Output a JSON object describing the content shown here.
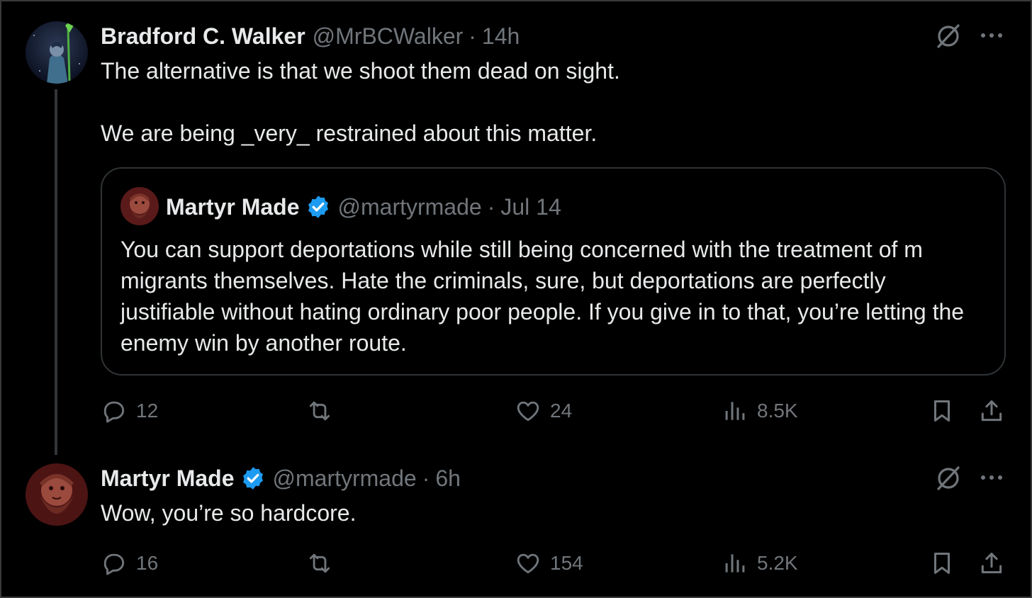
{
  "tweets": [
    {
      "name": "Bradford C. Walker",
      "handle": "@MrBCWalker",
      "separator": "·",
      "time": "14h",
      "verified": false,
      "text": "The alternative is that we shoot them dead on sight.\n\nWe are being _very_ restrained about this matter.",
      "quote": {
        "name": "Martyr Made",
        "handle": "@martyrmade",
        "separator": "·",
        "time": "Jul 14",
        "verified": true,
        "text": "You can support deportations while still being concerned with the treatment of m migrants themselves. Hate the criminals, sure, but deportations are perfectly justifiable without hating ordinary poor people. If you give in to that, you’re letting the enemy win by another route."
      },
      "actions": {
        "replies": "12",
        "reposts": "",
        "likes": "24",
        "views": "8.5K"
      }
    },
    {
      "name": "Martyr Made",
      "handle": "@martyrmade",
      "separator": "·",
      "time": "6h",
      "verified": true,
      "text": "Wow, you’re so hardcore.",
      "actions": {
        "replies": "16",
        "reposts": "",
        "likes": "154",
        "views": "5.2K"
      }
    }
  ],
  "icons": {
    "reply": "speech-bubble-icon",
    "repost": "repost-arrows-icon",
    "like": "heart-icon",
    "views": "bar-chart-icon",
    "bookmark": "bookmark-icon",
    "share": "share-upload-icon",
    "grok": "grok-slash-icon",
    "more": "more-dots-icon",
    "verified": "verified-badge-icon"
  },
  "colors": {
    "background": "#000000",
    "text": "#e7e9ea",
    "secondary": "#71767b",
    "border": "#2f3336",
    "verified": "#1d9bf0"
  }
}
